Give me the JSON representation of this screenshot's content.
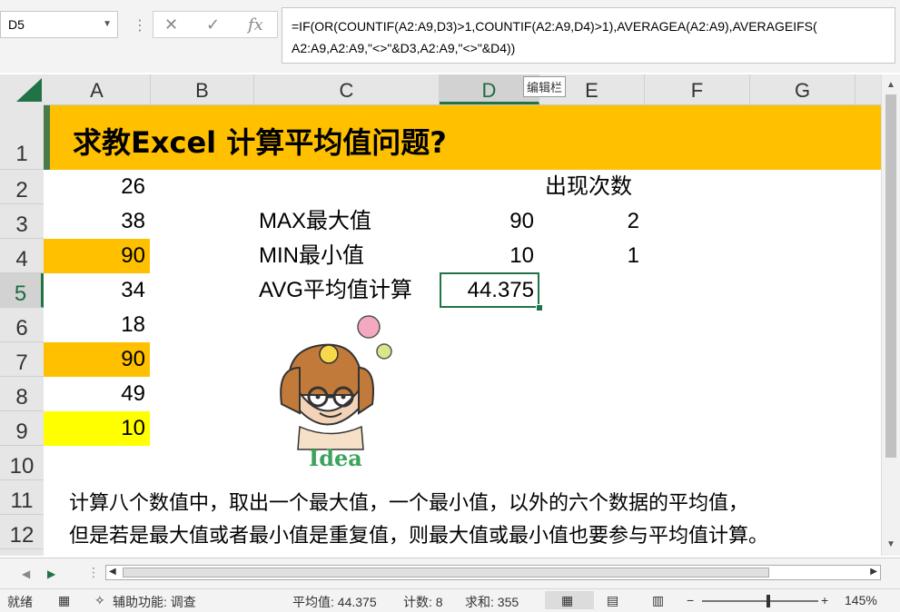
{
  "name_box": "D5",
  "formula_tools": {
    "cancel": "✕",
    "enter": "✓",
    "fx": "fx"
  },
  "formula": "=IF(OR(COUNTIF(A2:A9,D3)>1,COUNTIF(A2:A9,D4)>1),AVERAGEA(A2:A9),AVERAGEIFS(\nA2:A9,A2:A9,\"<>\"&D3,A2:A9,\"<>\"&D4))",
  "tooltip": "编辑栏",
  "columns": [
    "A",
    "B",
    "C",
    "D",
    "E",
    "F",
    "G"
  ],
  "rows": [
    "1",
    "2",
    "3",
    "4",
    "5",
    "6",
    "7",
    "8",
    "9",
    "10",
    "11",
    "12"
  ],
  "title": "求教Excel 计算平均值问题?",
  "col_a_values": [
    "26",
    "38",
    "90",
    "34",
    "18",
    "90",
    "49",
    "10"
  ],
  "labels": {
    "count_header": "出现次数",
    "max": "MAX最大值",
    "min": "MIN最小值",
    "avg": "AVG平均值计算"
  },
  "values": {
    "max": "90",
    "max_count": "2",
    "min": "10",
    "min_count": "1",
    "avg": "44.375"
  },
  "notes": [
    "计算八个数值中，取出一个最大值，一个最小值，以外的六个数据的平均值，",
    "但是若是最大值或者最小值是重复值，则最大值或最小值也要参与平均值计算。"
  ],
  "cartoon_text": "Idea",
  "status": {
    "ready": "就绪",
    "accessibility": "辅助功能: 调查",
    "average": "平均值: 44.375",
    "count": "计数: 8",
    "sum": "求和: 355",
    "zoom": "145%",
    "zoom_minus": "−",
    "zoom_plus": "+"
  },
  "colors": {
    "accent": "#217346",
    "title_band": "#ffc000",
    "highlight_yellow": "#ffff00"
  }
}
